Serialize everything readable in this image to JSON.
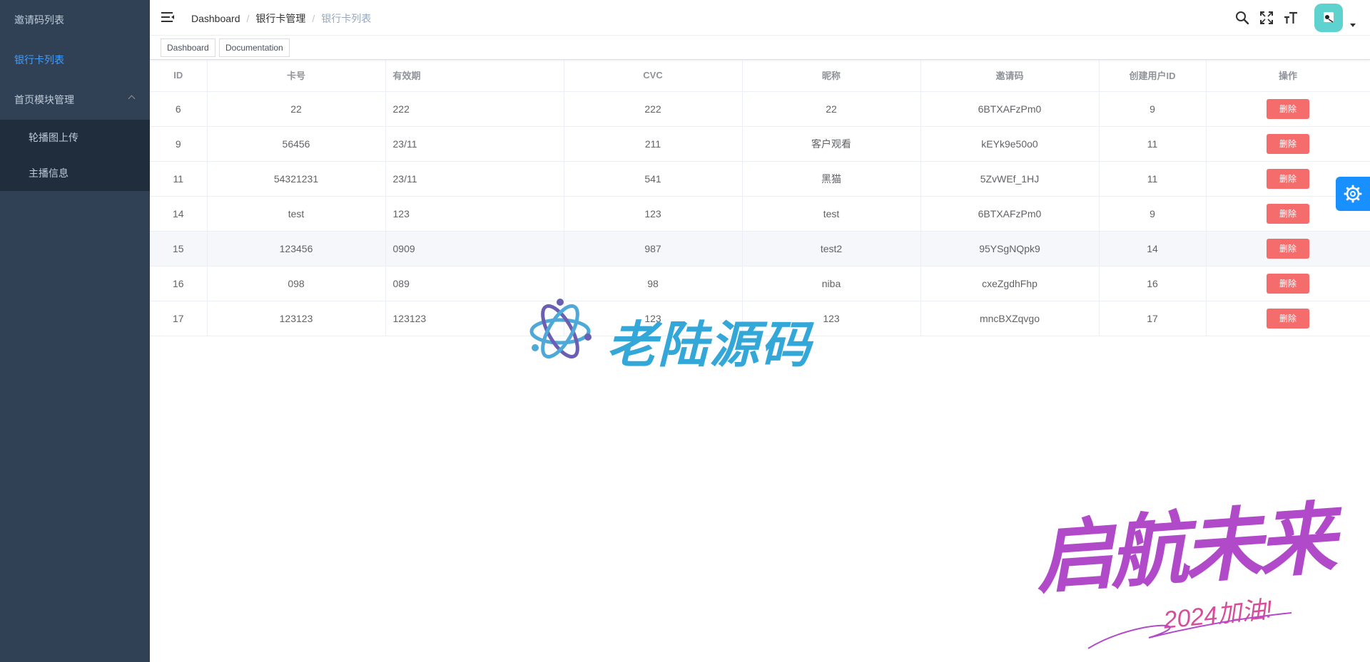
{
  "sidebar": {
    "items": [
      {
        "label": "邀请码列表"
      },
      {
        "label": "银行卡列表"
      },
      {
        "label": "首页模块管理"
      }
    ],
    "submenu": [
      {
        "label": "轮播图上传"
      },
      {
        "label": "主播信息"
      }
    ],
    "active_color": "#409eff",
    "bg_color": "#304156"
  },
  "navbar": {
    "breadcrumb": [
      "Dashboard",
      "银行卡管理",
      "银行卡列表"
    ],
    "icons": [
      "search-icon",
      "fullscreen-icon",
      "font-size-icon"
    ]
  },
  "tags": [
    "Dashboard",
    "Documentation"
  ],
  "table": {
    "columns": [
      "ID",
      "卡号",
      "有效期",
      "CVC",
      "昵称",
      "邀请码",
      "创建用户ID",
      "操作"
    ],
    "rows": [
      {
        "id": "6",
        "card": "22",
        "expiry": "222",
        "cvc": "222",
        "nickname": "22",
        "invite": "6BTXAFzPm0",
        "uid": "9",
        "action": "删除"
      },
      {
        "id": "9",
        "card": "56456",
        "expiry": "23/11",
        "cvc": "211",
        "nickname": "客户观看",
        "invite": "kEYk9e50o0",
        "uid": "11",
        "action": "删除"
      },
      {
        "id": "11",
        "card": "54321231",
        "expiry": "23/11",
        "cvc": "541",
        "nickname": "黑猫",
        "invite": "5ZvWEf_1HJ",
        "uid": "11",
        "action": "删除"
      },
      {
        "id": "14",
        "card": "test",
        "expiry": "123",
        "cvc": "123",
        "nickname": "test",
        "invite": "6BTXAFzPm0",
        "uid": "9",
        "action": "删除"
      },
      {
        "id": "15",
        "card": "123456",
        "expiry": "0909",
        "cvc": "987",
        "nickname": "test2",
        "invite": "95YSgNQpk9",
        "uid": "14",
        "action": "删除"
      },
      {
        "id": "16",
        "card": "098",
        "expiry": "089",
        "cvc": "98",
        "nickname": "niba",
        "invite": "cxeZgdhFhp",
        "uid": "16",
        "action": "删除"
      },
      {
        "id": "17",
        "card": "123123",
        "expiry": "123123",
        "cvc": "123",
        "nickname": "123",
        "invite": "mncBXZqvgo",
        "uid": "17",
        "action": "删除"
      }
    ]
  },
  "watermark": {
    "center_text": "老陆源码",
    "corner_text": "启航未来",
    "corner_sub": "2024加油!"
  },
  "colors": {
    "delete_button": "#f56c6c",
    "settings_button": "#1890ff"
  }
}
